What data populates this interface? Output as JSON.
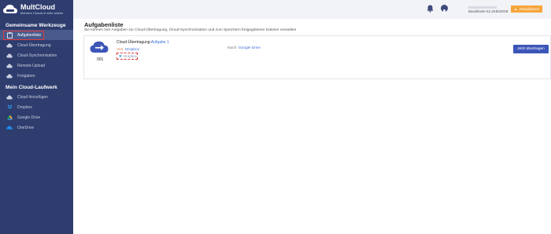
{
  "app": {
    "brand": "MultCloud",
    "tagline": "Mehrere Clouds in eine setzen"
  },
  "sidebar": {
    "section1_title": "Gemeinsame Werkzeuge",
    "tools": [
      {
        "label": "Aufgabenliste",
        "icon": "clipboard-icon"
      },
      {
        "label": "Cloud-Übertragung",
        "icon": "cloud-transfer-icon"
      },
      {
        "label": "Cloud-Synchronisation",
        "icon": "cloud-sync-icon"
      },
      {
        "label": "Remote-Upload",
        "icon": "upload-icon"
      },
      {
        "label": "Freigaben",
        "icon": "share-icon"
      }
    ],
    "section2_title": "Mein Cloud-Laufwerk",
    "drives": [
      {
        "label": "Cloud hinzufügen",
        "icon": "cloud-add-icon"
      },
      {
        "label": "Dropbox",
        "icon": "dropbox-icon"
      },
      {
        "label": "Google Drive",
        "icon": "google-drive-icon"
      },
      {
        "label": "OneDrive",
        "icon": "onedrive-icon"
      }
    ]
  },
  "topbar": {
    "bandwidth": "Bandbreite 62.2KB/30GB",
    "upgrade_label": "Aktualisieren"
  },
  "main": {
    "title": "Aufgabenliste",
    "description": "Sie können hier Aufgaben zur Cloud-Übertragung, Cloud-Synchronisation und zum Speichern freigegebener Dateien verwalten"
  },
  "task": {
    "number": "001",
    "type_label": "Cloud-Übertragung:",
    "name": "Aufgabe 1",
    "from_label": "Von:",
    "from_value": "Dropbox",
    "source_item": "Dropbox",
    "to_label": "Nach:",
    "to_value": "Google Drive",
    "button_label": "Jetzt übertragen"
  },
  "colors": {
    "sidebar_bg": "#2e3d6e",
    "accent": "#3c56b8",
    "upgrade": "#f7a53b",
    "highlight": "#e03b3b"
  }
}
